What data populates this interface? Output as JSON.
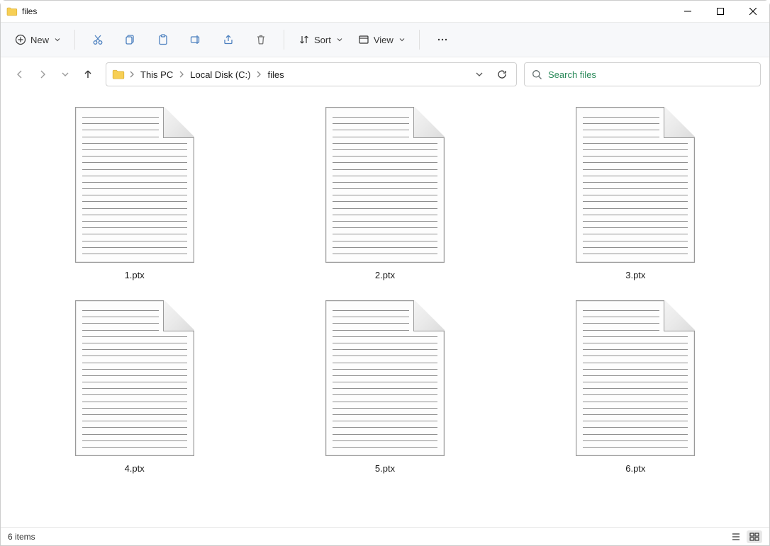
{
  "window": {
    "title": "files"
  },
  "toolbar": {
    "new_label": "New",
    "sort_label": "Sort",
    "view_label": "View"
  },
  "breadcrumb": {
    "items": [
      "This PC",
      "Local Disk (C:)",
      "files"
    ]
  },
  "search": {
    "placeholder": "Search files"
  },
  "files": [
    {
      "name": "1.ptx"
    },
    {
      "name": "2.ptx"
    },
    {
      "name": "3.ptx"
    },
    {
      "name": "4.ptx"
    },
    {
      "name": "5.ptx"
    },
    {
      "name": "6.ptx"
    }
  ],
  "status": {
    "item_count_label": "6 items"
  }
}
